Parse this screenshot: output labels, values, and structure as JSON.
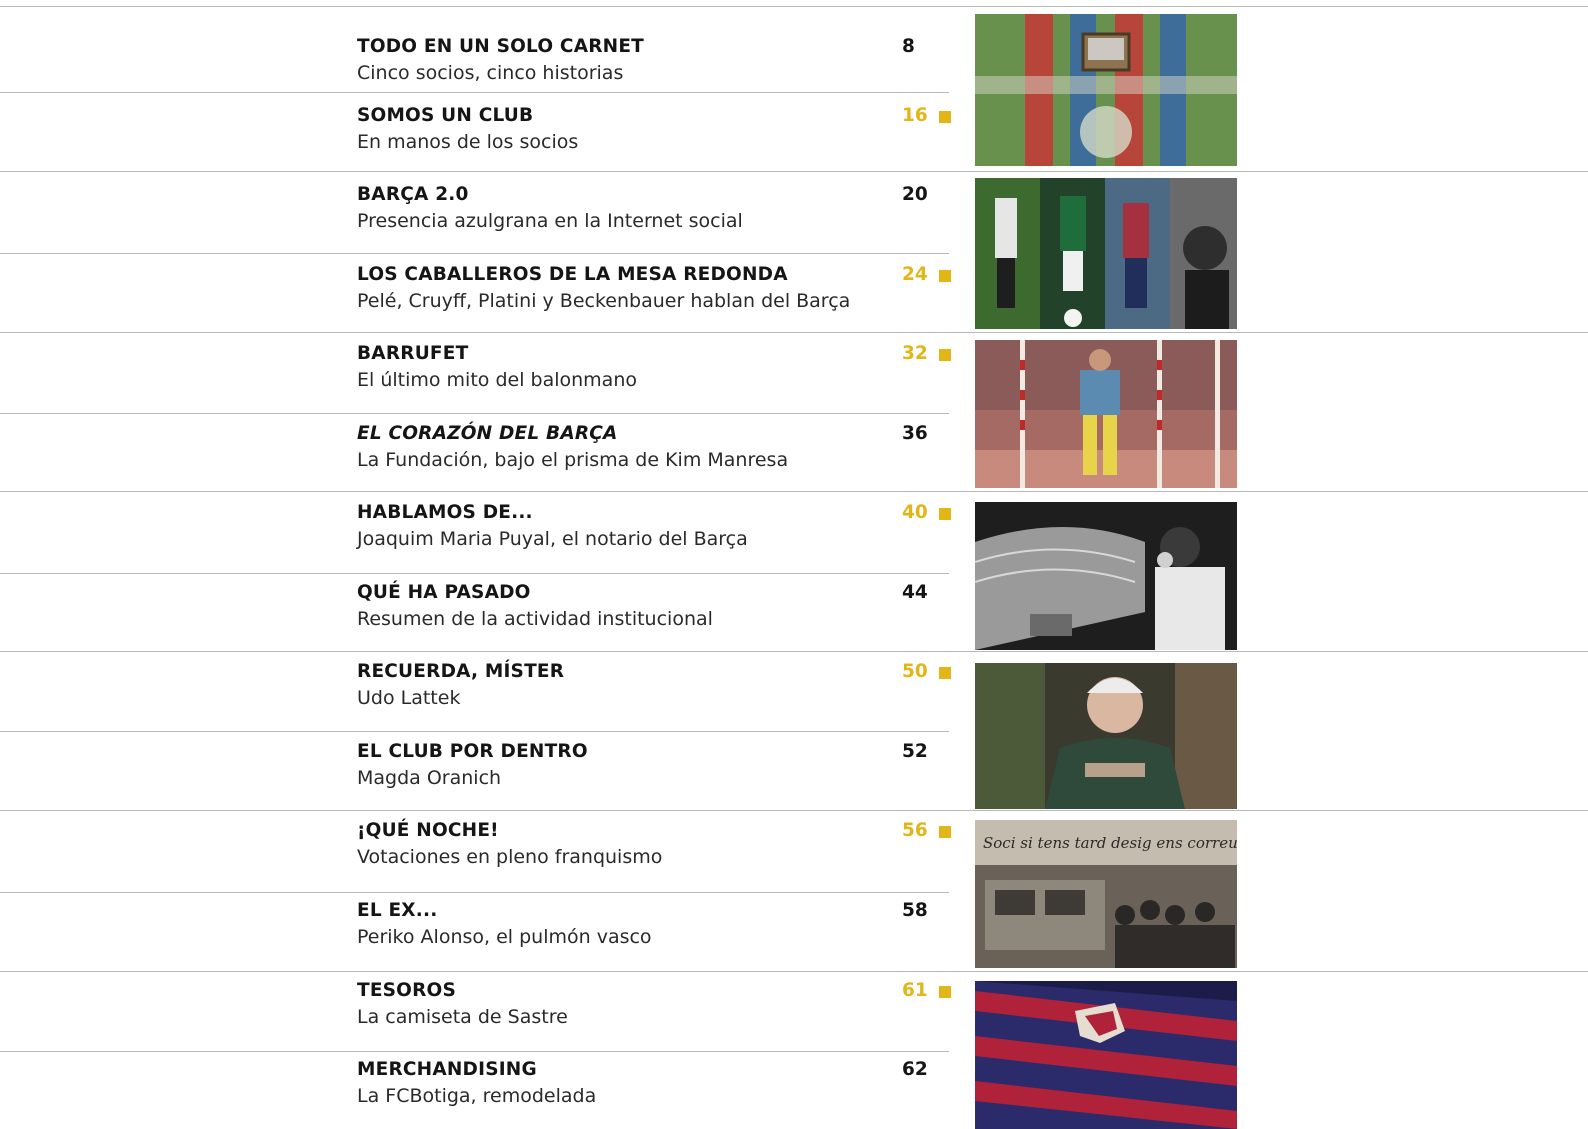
{
  "colors": {
    "accent": "#e3b618",
    "rule": "#b9b9b9",
    "text": "#151515"
  },
  "entries": [
    {
      "title": "TODO EN UN SOLO CARNET",
      "subtitle": "Cinco socios, cinco historias",
      "page": "8",
      "highlight": false,
      "italic": false
    },
    {
      "title": "SOMOS UN CLUB",
      "subtitle": "En manos de los socios",
      "page": "16",
      "highlight": true,
      "italic": false
    },
    {
      "title": "BARÇA 2.0",
      "subtitle": "Presencia azulgrana en la Internet social",
      "page": "20",
      "highlight": false,
      "italic": false
    },
    {
      "title": "LOS CABALLEROS DE LA MESA REDONDA",
      "subtitle": "Pelé, Cruyff, Platini y Beckenbauer hablan del Barça",
      "page": "24",
      "highlight": true,
      "italic": false
    },
    {
      "title": "BARRUFET",
      "subtitle": "El último mito del balonmano",
      "page": "32",
      "highlight": true,
      "italic": false
    },
    {
      "title": "EL CORAZÓN DEL BARÇA",
      "subtitle": "La Fundación, bajo el prisma de Kim Manresa",
      "page": "36",
      "highlight": false,
      "italic": true
    },
    {
      "title": "HABLAMOS DE...",
      "subtitle": "Joaquim Maria Puyal, el notario del Barça",
      "page": "40",
      "highlight": true,
      "italic": false
    },
    {
      "title": "QUÉ HA PASADO",
      "subtitle": "Resumen de la actividad institucional",
      "page": "44",
      "highlight": false,
      "italic": false
    },
    {
      "title": "RECUERDA, MÍSTER",
      "subtitle": "Udo Lattek",
      "page": "50",
      "highlight": true,
      "italic": false
    },
    {
      "title": "EL CLUB POR DENTRO",
      "subtitle": "Magda Oranich",
      "page": "52",
      "highlight": false,
      "italic": false
    },
    {
      "title": "¡QUÉ NOCHE!",
      "subtitle": "Votaciones en pleno franquismo",
      "page": "56",
      "highlight": true,
      "italic": false
    },
    {
      "title": "EL EX...",
      "subtitle": "Periko Alonso, el pulmón vasco",
      "page": "58",
      "highlight": false,
      "italic": false
    },
    {
      "title": "TESOROS",
      "subtitle": "La camiseta de Sastre",
      "page": "61",
      "highlight": true,
      "italic": false
    },
    {
      "title": "MERCHANDISING",
      "subtitle": "La FCBotiga, remodelada",
      "page": "62",
      "highlight": false,
      "italic": false
    }
  ],
  "photos": {
    "banner_text": "Soci si tens tard desig ens correus"
  }
}
